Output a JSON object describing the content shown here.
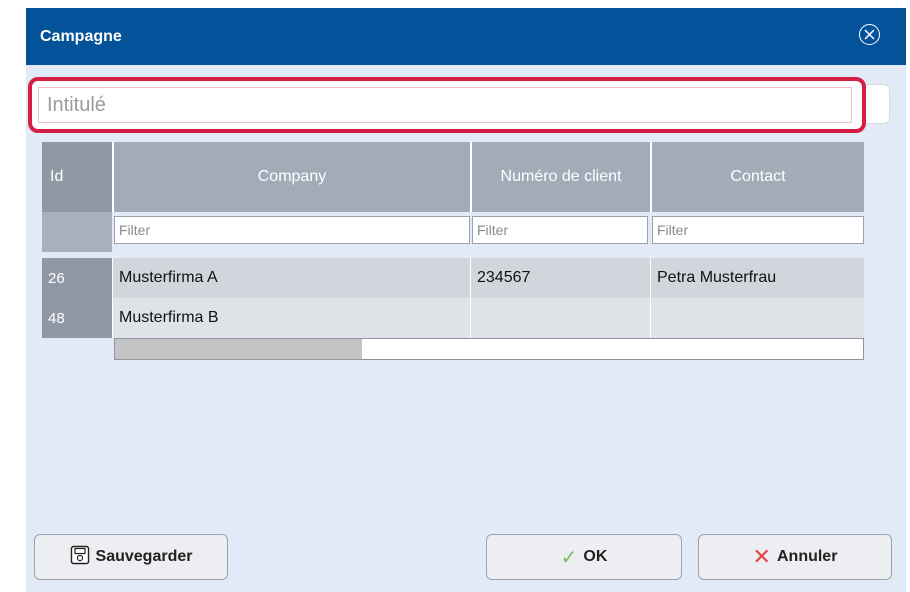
{
  "window": {
    "title": "Campagne"
  },
  "form": {
    "title_placeholder": "Intitulé"
  },
  "table": {
    "columns": [
      "Id",
      "Company",
      "Numéro de client",
      "Contact"
    ],
    "filter_placeholder": "Filter",
    "rows": [
      {
        "id": "26",
        "company": "Musterfirma A",
        "customer_number": "234567",
        "contact": "Petra Musterfrau"
      },
      {
        "id": "48",
        "company": "Musterfirma B",
        "customer_number": "",
        "contact": ""
      }
    ],
    "horizontal_scroll_fraction": 0.33
  },
  "buttons": {
    "save": "Sauvegarder",
    "ok": "OK",
    "cancel": "Annuler"
  },
  "icons": {
    "close": "close-circle-icon",
    "save": "save-icon",
    "ok": "check-icon",
    "cancel": "x-icon"
  },
  "colors": {
    "titlebar": "#04529a",
    "highlight": "#d51e45",
    "dialog_bg": "#e3eaf7"
  }
}
